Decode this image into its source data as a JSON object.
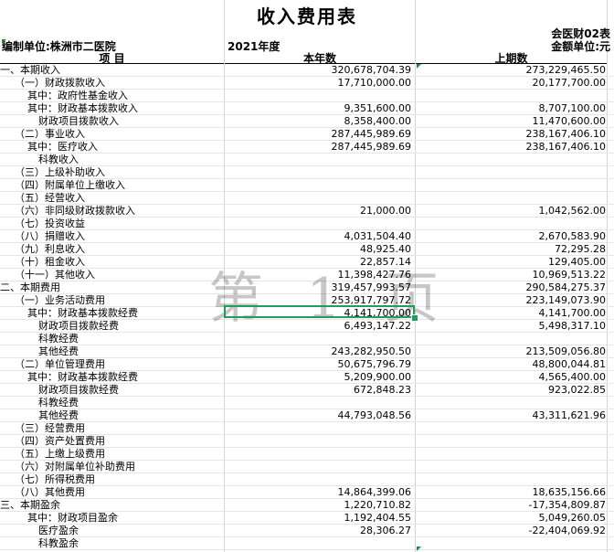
{
  "title": "收入费用表",
  "form_code": "会医财02表",
  "unit_label": "编制单位:株洲市二医院",
  "year_label": "2021年度",
  "currency_label": "金额单位:元",
  "columns": {
    "item": "项          目",
    "current": "本年数",
    "previous": "上期数"
  },
  "watermark": "第 1 页",
  "rows": [
    {
      "label": "一、本期收入",
      "cur": "320,678,704.39",
      "prev": "273,229,465.50",
      "indent": 0
    },
    {
      "label": "（一）财政拨款收入",
      "cur": "17,710,000.00",
      "prev": "20,177,700.00",
      "indent": 1
    },
    {
      "label": "其中：政府性基金收入",
      "cur": "",
      "prev": "",
      "indent": 2
    },
    {
      "label": "其中：财政基本拨款收入",
      "cur": "9,351,600.00",
      "prev": "8,707,100.00",
      "indent": 2
    },
    {
      "label": "财政项目拨款收入",
      "cur": "8,358,400.00",
      "prev": "11,470,600.00",
      "indent": 3
    },
    {
      "label": "（二）事业收入",
      "cur": "287,445,989.69",
      "prev": "238,167,406.10",
      "indent": 1
    },
    {
      "label": "其中：医疗收入",
      "cur": "287,445,989.69",
      "prev": "238,167,406.10",
      "indent": 2
    },
    {
      "label": "科教收入",
      "cur": "",
      "prev": "",
      "indent": 3
    },
    {
      "label": "（三）上级补助收入",
      "cur": "",
      "prev": "",
      "indent": 1
    },
    {
      "label": "（四）附属单位上缴收入",
      "cur": "",
      "prev": "",
      "indent": 1
    },
    {
      "label": "（五）经营收入",
      "cur": "",
      "prev": "",
      "indent": 1
    },
    {
      "label": "（六）非同级财政拨款收入",
      "cur": "21,000.00",
      "prev": "1,042,562.00",
      "indent": 1
    },
    {
      "label": "（七）投资收益",
      "cur": "",
      "prev": "",
      "indent": 1
    },
    {
      "label": "（八）捐赠收入",
      "cur": "4,031,504.40",
      "prev": "2,670,583.90",
      "indent": 1
    },
    {
      "label": "（九）利息收入",
      "cur": "48,925.40",
      "prev": "72,295.28",
      "indent": 1
    },
    {
      "label": "（十）租金收入",
      "cur": "22,857.14",
      "prev": "129,405.00",
      "indent": 1
    },
    {
      "label": "（十一）其他收入",
      "cur": "11,398,427.76",
      "prev": "10,969,513.22",
      "indent": 1
    },
    {
      "label": "二、本期费用",
      "cur": "319,457,993.57",
      "prev": "290,584,275.37",
      "indent": 0
    },
    {
      "label": "（一）业务活动费用",
      "cur": "253,917,797.72",
      "prev": "223,149,073.90",
      "indent": 1
    },
    {
      "label": "其中：财政基本拨款经费",
      "cur": "4,141,700.00",
      "prev": "4,141,700.00",
      "indent": 2
    },
    {
      "label": "财政项目拨款经费",
      "cur": "6,493,147.22",
      "prev": "5,498,317.10",
      "indent": 3
    },
    {
      "label": "科教经费",
      "cur": "",
      "prev": "",
      "indent": 3
    },
    {
      "label": "其他经费",
      "cur": "243,282,950.50",
      "prev": "213,509,056.80",
      "indent": 3
    },
    {
      "label": "（二）单位管理费用",
      "cur": "50,675,796.79",
      "prev": "48,800,044.81",
      "indent": 1
    },
    {
      "label": "其中：财政基本拨款经费",
      "cur": "5,209,900.00",
      "prev": "4,565,400.00",
      "indent": 2
    },
    {
      "label": "财政项目拨款经费",
      "cur": "672,848.23",
      "prev": "923,022.85",
      "indent": 3
    },
    {
      "label": "科教经费",
      "cur": "",
      "prev": "",
      "indent": 3
    },
    {
      "label": "其他经费",
      "cur": "44,793,048.56",
      "prev": "43,311,621.96",
      "indent": 3
    },
    {
      "label": "（三）经营费用",
      "cur": "",
      "prev": "",
      "indent": 1
    },
    {
      "label": "（四）资产处置费用",
      "cur": "",
      "prev": "",
      "indent": 1
    },
    {
      "label": "（五）上缴上级费用",
      "cur": "",
      "prev": "",
      "indent": 1
    },
    {
      "label": "（六）对附属单位补助费用",
      "cur": "",
      "prev": "",
      "indent": 1
    },
    {
      "label": "（七）所得税费用",
      "cur": "",
      "prev": "",
      "indent": 1
    },
    {
      "label": "（八）其他费用",
      "cur": "14,864,399.06",
      "prev": "18,635,156.66",
      "indent": 1
    },
    {
      "label": "三、本期盈余",
      "cur": "1,220,710.82",
      "prev": "-17,354,809.87",
      "indent": 0
    },
    {
      "label": "其中：财政项目盈余",
      "cur": "1,192,404.55",
      "prev": "5,049,260.05",
      "indent": 2
    },
    {
      "label": "医疗盈余",
      "cur": "28,306.27",
      "prev": "-22,404,069.92",
      "indent": 3
    },
    {
      "label": "科教盈余",
      "cur": "",
      "prev": "",
      "indent": 3
    }
  ]
}
